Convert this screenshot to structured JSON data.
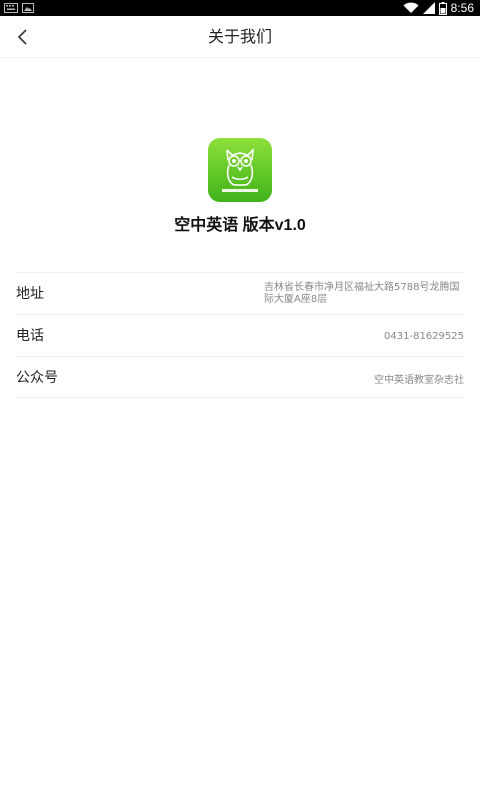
{
  "status_bar": {
    "time": "8:56",
    "icons": [
      "keyboard-icon",
      "image-icon",
      "wifi-icon",
      "signal-icon",
      "battery-icon"
    ]
  },
  "header": {
    "title": "关于我们",
    "back_icon": "chevron-left-icon"
  },
  "app": {
    "name": "空中英语 版本v1.0",
    "logo_icon": "owl-logo-icon",
    "colors": {
      "logo_green_top": "#8ee03a",
      "logo_green_bottom": "#3fb31a"
    }
  },
  "info": [
    {
      "label": "地址",
      "value": "吉林省长春市净月区福祉大路5788号龙腾国际大厦A座8层"
    },
    {
      "label": "电话",
      "value": "0431-81629525"
    },
    {
      "label": "公众号",
      "value": "空中英语教室杂志社"
    }
  ]
}
